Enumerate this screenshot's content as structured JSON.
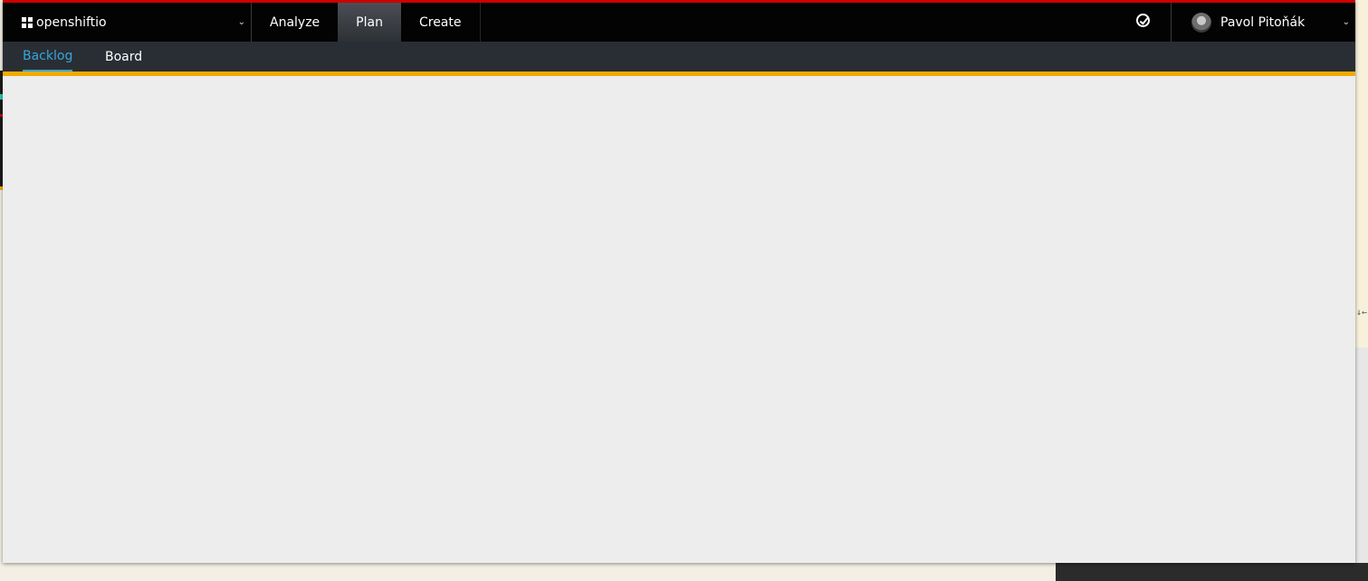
{
  "topbar": {
    "brand_label": "openshiftio",
    "nav": [
      {
        "label": "Analyze",
        "active": false
      },
      {
        "label": "Plan",
        "active": true
      },
      {
        "label": "Create",
        "active": false
      }
    ],
    "user_name": "Pavol Pitoňák",
    "accent_color": "#cc0000"
  },
  "subnav": {
    "tabs": [
      {
        "label": "Backlog",
        "active": true
      },
      {
        "label": "Board",
        "active": false
      }
    ],
    "active_color": "#39a5dc"
  },
  "banner": {
    "color": "#f0ab00",
    "icon": "flask-icon"
  },
  "background": {
    "right_mark": "↓←"
  }
}
